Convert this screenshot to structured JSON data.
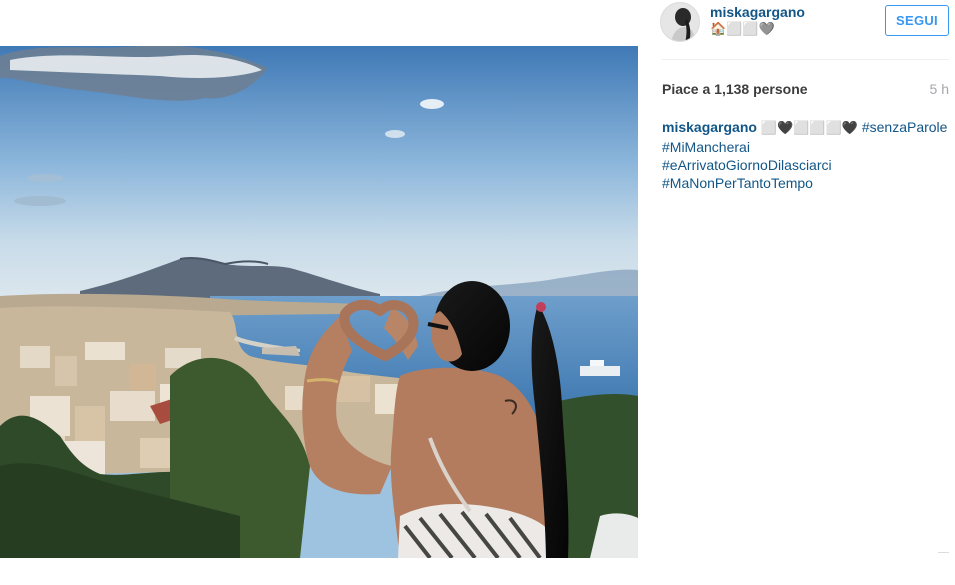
{
  "post": {
    "photo_alt": "",
    "username": "miskagargano",
    "user_subtitle": "🏠⬜⬜🩶",
    "follow_label": "SEGUI",
    "likes_text": "Piace a 1,138 persone",
    "time_ago": "5 h",
    "caption": {
      "author": "miskagargano",
      "emoji_text": "⬜🖤⬜⬜⬜🖤",
      "hashtags": [
        "#senzaParole",
        "#MiMancherai",
        "#eArrivatoGiornoDilasciarci",
        "#MaNonPerTantoTempo"
      ]
    }
  },
  "colors": {
    "link": "#125688",
    "follow_accent": "#3897f0",
    "muted": "#a5a7aa"
  },
  "icons": {
    "avatar": "profile-photo"
  }
}
